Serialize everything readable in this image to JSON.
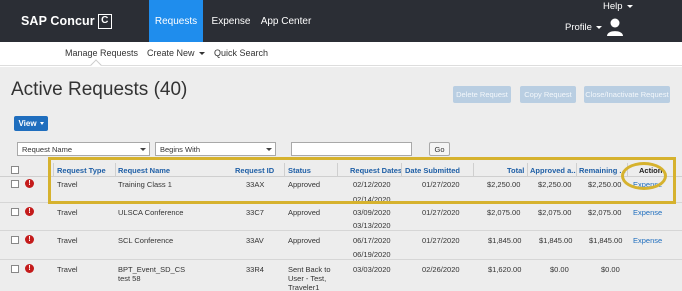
{
  "header": {
    "brand": "SAP Concur",
    "brand_mark": "C",
    "nav": [
      "Requests",
      "Expense",
      "App Center"
    ],
    "help": "Help",
    "profile": "Profile"
  },
  "subnav": {
    "manage": "Manage Requests",
    "create": "Create New",
    "quick": "Quick Search"
  },
  "page": {
    "title": "Active Requests (40)",
    "buttons": {
      "delete": "Delete Request",
      "copy": "Copy Request",
      "close": "Close/Inactivate Request"
    },
    "view": "View"
  },
  "filter": {
    "field": "Request Name",
    "operator": "Begins With",
    "value": "",
    "go": "Go"
  },
  "table": {
    "headers": {
      "type": "Request Type",
      "name": "Request Name",
      "id": "Request ID",
      "status": "Status",
      "dates": "Request Dates",
      "submitted": "Date Submitted",
      "total": "Total",
      "approved": "Approved a...",
      "remaining": "Remaining ...",
      "action": "Action"
    },
    "rows": [
      {
        "type": "Travel",
        "name": "Training Class 1",
        "id": "33AX",
        "status": [
          "Approved"
        ],
        "start": "02/12/2020",
        "end": "02/14/2020",
        "submitted": "01/27/2020",
        "total": "$2,250.00",
        "approved": "$2,250.00",
        "remaining": "$2,250.00",
        "action": "Expense"
      },
      {
        "type": "Travel",
        "name": "ULSCA Conference",
        "id": "33C7",
        "status": [
          "Approved"
        ],
        "start": "03/09/2020",
        "end": "03/13/2020",
        "submitted": "01/27/2020",
        "total": "$2,075.00",
        "approved": "$2,075.00",
        "remaining": "$2,075.00",
        "action": "Expense"
      },
      {
        "type": "Travel",
        "name": "SCL Conference",
        "id": "33AV",
        "status": [
          "Approved"
        ],
        "start": "06/17/2020",
        "end": "06/19/2020",
        "submitted": "01/27/2020",
        "total": "$1,845.00",
        "approved": "$1,845.00",
        "remaining": "$1,845.00",
        "action": "Expense"
      },
      {
        "type": "Travel",
        "name_lines": [
          "BPT_Event_SD_CS",
          "test 58"
        ],
        "id": "33R4",
        "status": [
          "Sent Back to",
          "User - Test,",
          "Traveler1"
        ],
        "start": "03/03/2020",
        "end": "",
        "submitted": "02/26/2020",
        "total": "$1,620.00",
        "approved": "$0.00",
        "remaining": "$0.00",
        "action": ""
      }
    ]
  },
  "colors": {
    "topbar": "#2b2e35",
    "active_tab": "#1f8ded",
    "highlight": "#d6b22e",
    "link": "#1f6ebe",
    "alert": "#c41b1b"
  }
}
